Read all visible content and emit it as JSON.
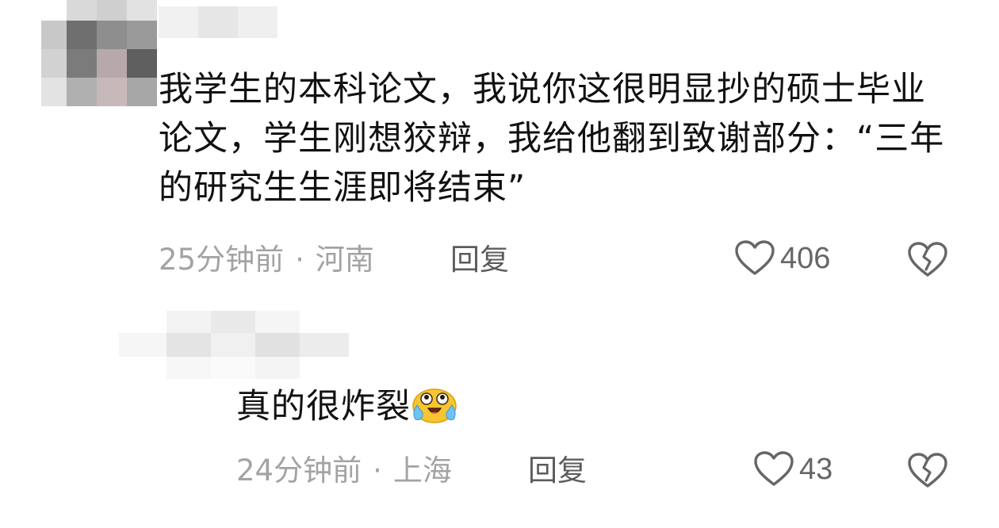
{
  "comments": [
    {
      "text": "我学生的本科论文，我说你这很明显抄的硕士毕业论文，学生刚想狡辩，我给他翻到致谢部分：“三年的研究生生涯即将结束”",
      "time": "25分钟前",
      "location": "河南",
      "reply_label": "回复",
      "likes": "406"
    },
    {
      "text": "真的很炸裂",
      "time": "24分钟前",
      "location": "上海",
      "reply_label": "回复",
      "likes": "43"
    }
  ],
  "separator": "·",
  "icons": {
    "like": "heart-outline-icon",
    "dislike": "broken-heart-icon",
    "emoji": "crying-face-emoji"
  },
  "colors": {
    "text_primary": "#111111",
    "text_meta": "#a3a3a3",
    "text_reply": "#5c5c5c",
    "icon_stroke": "#666666",
    "emoji_yellow": "#f7c531"
  }
}
